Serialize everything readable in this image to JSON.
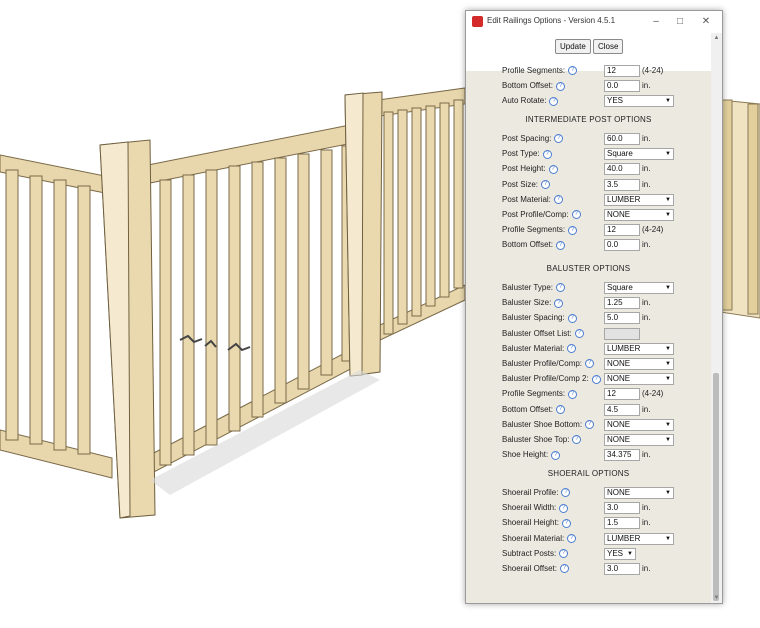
{
  "window": {
    "title": "Edit Railings Options - Version 4.5.1"
  },
  "toolbar": {
    "update_label": "Update",
    "close_label": "Close"
  },
  "help_glyph": "?",
  "rows_top": [
    {
      "label": "Profile Segments:",
      "value": "12",
      "unit": "(4-24)",
      "kind": "input"
    },
    {
      "label": "Bottom Offset:",
      "value": "0.0",
      "unit": "in.",
      "kind": "input"
    },
    {
      "label": "Auto Rotate:",
      "value": "YES",
      "unit": "",
      "kind": "select"
    }
  ],
  "sections": {
    "intermediate": "INTERMEDIATE POST OPTIONS",
    "baluster": "BALUSTER OPTIONS",
    "shoerail": "SHOERAIL OPTIONS"
  },
  "rows_intermediate": [
    {
      "label": "Post Spacing:",
      "value": "60.0",
      "unit": "in.",
      "kind": "input"
    },
    {
      "label": "Post Type:",
      "value": "Square",
      "unit": "",
      "kind": "select"
    },
    {
      "label": "Post Height:",
      "value": "40.0",
      "unit": "in.",
      "kind": "input"
    },
    {
      "label": "Post Size:",
      "value": "3.5",
      "unit": "in.",
      "kind": "input"
    },
    {
      "label": "Post Material:",
      "value": "LUMBER",
      "unit": "",
      "kind": "select"
    },
    {
      "label": "Post Profile/Comp:",
      "value": "NONE",
      "unit": "",
      "kind": "select"
    },
    {
      "label": "Profile Segments:",
      "value": "12",
      "unit": "(4-24)",
      "kind": "input"
    },
    {
      "label": "Bottom Offset:",
      "value": "0.0",
      "unit": "in.",
      "kind": "input"
    }
  ],
  "rows_baluster": [
    {
      "label": "Baluster Type:",
      "value": "Square",
      "unit": "",
      "kind": "select"
    },
    {
      "label": "Baluster Size:",
      "value": "1.25",
      "unit": "in.",
      "kind": "input"
    },
    {
      "label": "Baluster Spacing:",
      "value": "5.0",
      "unit": "in.",
      "kind": "input"
    },
    {
      "label": "Baluster Offset List:",
      "value": "",
      "unit": "",
      "kind": "disabled"
    },
    {
      "label": "Baluster Material:",
      "value": "LUMBER",
      "unit": "",
      "kind": "select"
    },
    {
      "label": "Baluster Profile/Comp:",
      "value": "NONE",
      "unit": "",
      "kind": "select"
    },
    {
      "label": "Baluster Profile/Comp 2:",
      "value": "NONE",
      "unit": "",
      "kind": "select"
    },
    {
      "label": "Profile Segments:",
      "value": "12",
      "unit": "(4-24)",
      "kind": "input"
    },
    {
      "label": "Bottom Offset:",
      "value": "4.5",
      "unit": "in.",
      "kind": "input"
    },
    {
      "label": "Baluster Shoe Bottom:",
      "value": "NONE",
      "unit": "",
      "kind": "select"
    },
    {
      "label": "Baluster Shoe Top:",
      "value": "NONE",
      "unit": "",
      "kind": "select"
    },
    {
      "label": "Shoe Height:",
      "value": "34.375",
      "unit": "in.",
      "kind": "input"
    }
  ],
  "rows_shoerail": [
    {
      "label": "Shoerail Profile:",
      "value": "NONE",
      "unit": "",
      "kind": "select"
    },
    {
      "label": "Shoerail Width:",
      "value": "3.0",
      "unit": "in.",
      "kind": "input"
    },
    {
      "label": "Shoerail Height:",
      "value": "1.5",
      "unit": "in.",
      "kind": "input"
    },
    {
      "label": "Shoerail Material:",
      "value": "LUMBER",
      "unit": "",
      "kind": "select"
    },
    {
      "label": "Subtract Posts:",
      "value": "YES",
      "unit": "",
      "kind": "select-small"
    },
    {
      "label": "Shoerail Offset:",
      "value": "3.0",
      "unit": "in.",
      "kind": "input"
    }
  ],
  "colors": {
    "wood": "#e8d7ac",
    "wood_dark": "#c9b27a",
    "accent": "#4a7cd0"
  },
  "icons": {
    "app": "sketchup-app-icon",
    "minimize": "minimize-icon",
    "maximize": "maximize-icon",
    "close": "close-icon"
  }
}
